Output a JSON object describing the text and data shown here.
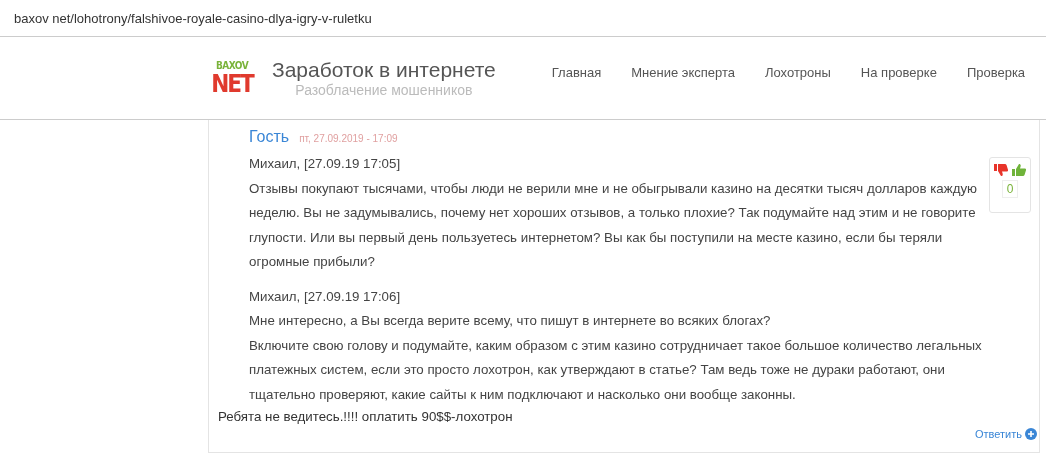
{
  "address_bar": {
    "url": "baxov net/lohotrony/falshivoe-royale-casino-dlya-igry-v-ruletku"
  },
  "header": {
    "logo": {
      "top": "BAXOV",
      "bottom": "NET"
    },
    "title": "Заработок в интернете",
    "subtitle": "Разоблачение мошенников",
    "nav": [
      {
        "label": "Главная"
      },
      {
        "label": "Мнение эксперта"
      },
      {
        "label": "Лохотроны"
      },
      {
        "label": "На проверке"
      },
      {
        "label": "Проверка"
      }
    ]
  },
  "comment": {
    "author": "Гость",
    "date": "пт, 27.09.2019 - 17:09",
    "quotes": [
      {
        "author": "Михаил, [27.09.19 17:05]",
        "paragraphs": [
          "Отзывы покупают тысячами, чтобы люди не верили мне и не обыгрывали казино на десятки тысяч долларов каждую неделю. Вы не задумывались, почему нет хороших отзывов, а только плохие? Так подумайте над этим и не говорите глупости. Или вы первый день пользуетесь интернетом? Вы как бы поступили на месте казино, если бы теряли огромные прибыли?"
        ]
      },
      {
        "author": "Михаил, [27.09.19 17:06]",
        "paragraphs": [
          "Мне интересно, а Вы всегда верите всему, что пишут в интернете во всяких блогах?",
          "Включите свою голову и подумайте, каким образом с этим казино сотрудничает такое большое количество легальных платежных систем, если это просто лохотрон, как утверждают в статье? Там ведь тоже не дураки работают, они тщательно проверяют, какие сайты к ним подключают и насколько они вообще законны."
        ]
      }
    ],
    "text": "Ребята не ведитесь.!!!! оплатить 90$$-лохотрон",
    "votes": {
      "count": "0"
    },
    "reply": "Ответить"
  }
}
